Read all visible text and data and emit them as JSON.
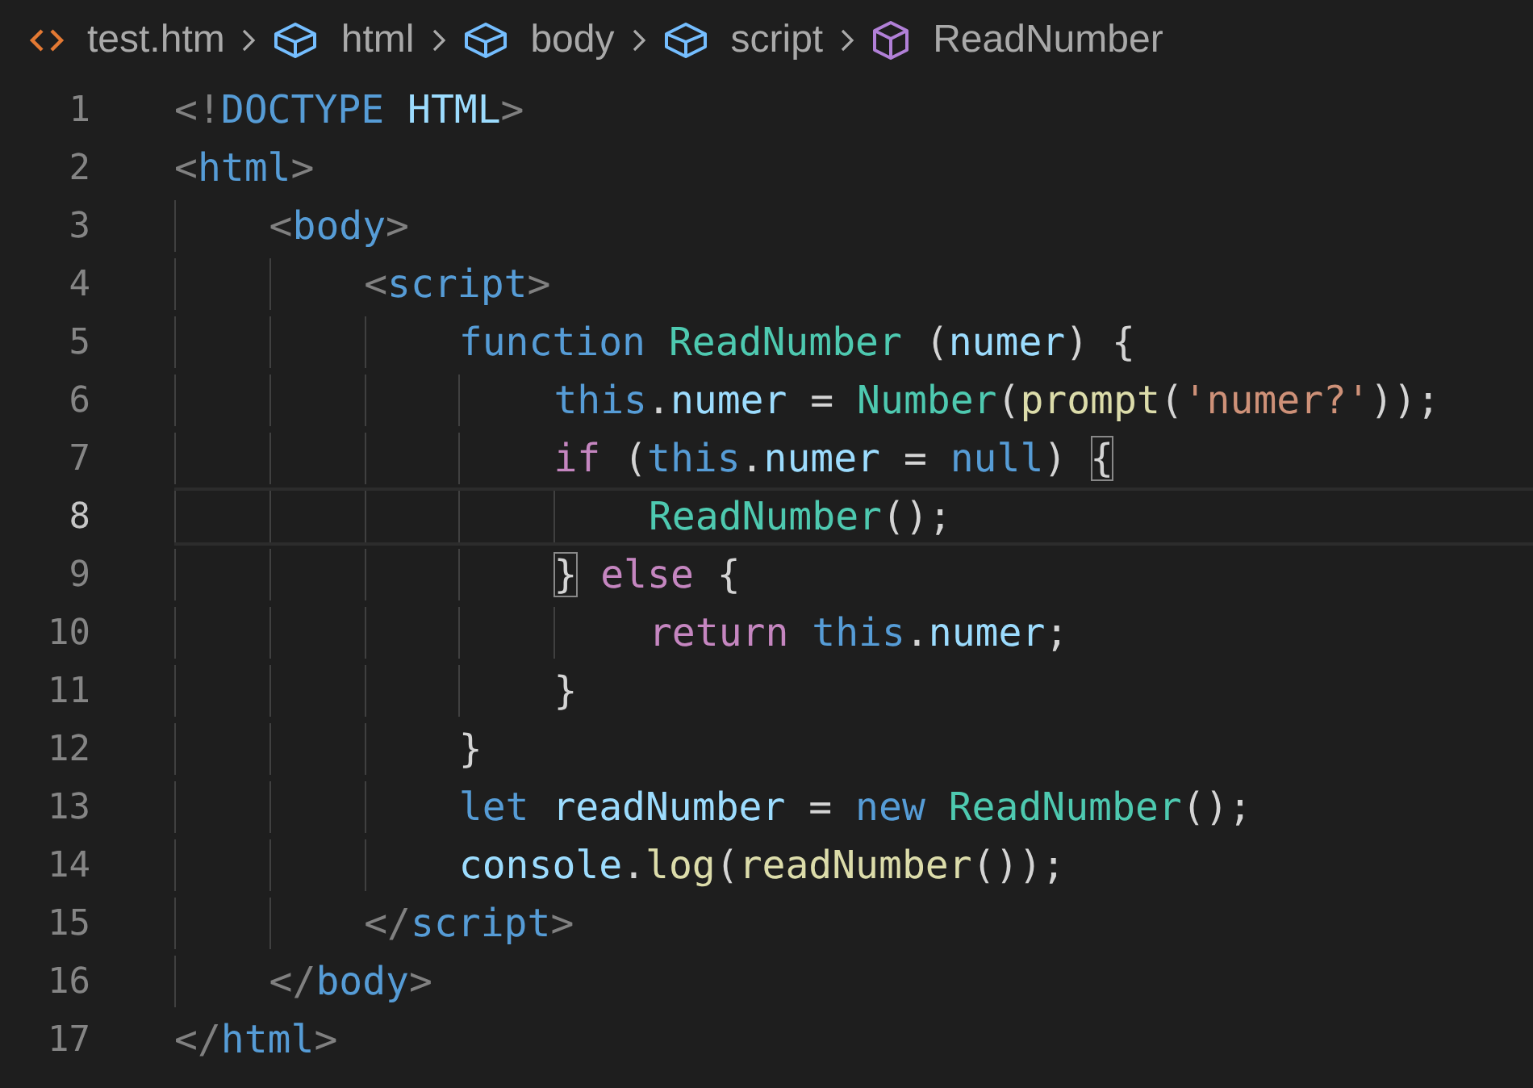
{
  "breadcrumbs": [
    {
      "kind": "file",
      "label": "test.htm"
    },
    {
      "kind": "element",
      "label": "html"
    },
    {
      "kind": "element",
      "label": "body"
    },
    {
      "kind": "element",
      "label": "script"
    },
    {
      "kind": "function",
      "label": "ReadNumber"
    }
  ],
  "lines": [
    {
      "number": "1",
      "current": false,
      "tokens": [
        {
          "kind": "punct",
          "text": "<!"
        },
        {
          "kind": "keyword",
          "text": "DOCTYPE "
        },
        {
          "kind": "var",
          "text": "HTML"
        },
        {
          "kind": "punct",
          "text": ">"
        }
      ]
    },
    {
      "number": "2",
      "current": false,
      "tokens": [
        {
          "kind": "punct",
          "text": "<"
        },
        {
          "kind": "keyword",
          "text": "html"
        },
        {
          "kind": "punct",
          "text": ">"
        }
      ]
    },
    {
      "number": "3",
      "current": false,
      "tokens": [
        {
          "kind": "punct",
          "text": "    <"
        },
        {
          "kind": "keyword",
          "text": "body"
        },
        {
          "kind": "punct",
          "text": ">"
        }
      ]
    },
    {
      "number": "4",
      "current": false,
      "tokens": [
        {
          "kind": "punct",
          "text": "        <"
        },
        {
          "kind": "keyword",
          "text": "script"
        },
        {
          "kind": "punct",
          "text": ">"
        }
      ]
    },
    {
      "number": "5",
      "current": false,
      "tokens": [
        {
          "kind": "keyword",
          "text": "            function "
        },
        {
          "kind": "type",
          "text": "ReadNumber"
        },
        {
          "kind": "text",
          "text": " ("
        },
        {
          "kind": "var",
          "text": "numer"
        },
        {
          "kind": "text",
          "text": ") {"
        }
      ]
    },
    {
      "number": "6",
      "current": false,
      "tokens": [
        {
          "kind": "keyword",
          "text": "                this"
        },
        {
          "kind": "text",
          "text": "."
        },
        {
          "kind": "var",
          "text": "numer"
        },
        {
          "kind": "text",
          "text": " = "
        },
        {
          "kind": "type",
          "text": "Number"
        },
        {
          "kind": "text",
          "text": "("
        },
        {
          "kind": "method",
          "text": "prompt"
        },
        {
          "kind": "text",
          "text": "("
        },
        {
          "kind": "string",
          "text": "'numer?'"
        },
        {
          "kind": "text",
          "text": "));"
        }
      ]
    },
    {
      "number": "7",
      "current": false,
      "tokens": [
        {
          "kind": "control",
          "text": "                if"
        },
        {
          "kind": "text",
          "text": " ("
        },
        {
          "kind": "keyword",
          "text": "this"
        },
        {
          "kind": "text",
          "text": "."
        },
        {
          "kind": "var",
          "text": "numer"
        },
        {
          "kind": "text",
          "text": " = "
        },
        {
          "kind": "keyword",
          "text": "null"
        },
        {
          "kind": "text",
          "text": ") "
        },
        {
          "kind": "bracket",
          "text": "{"
        }
      ]
    },
    {
      "number": "8",
      "current": true,
      "tokens": [
        {
          "kind": "type",
          "text": "                    ReadNumber"
        },
        {
          "kind": "text",
          "text": "();"
        }
      ]
    },
    {
      "number": "9",
      "current": false,
      "tokens": [
        {
          "kind": "bracket",
          "text": "                }"
        },
        {
          "kind": "control",
          "text": " else"
        },
        {
          "kind": "text",
          "text": " {"
        }
      ]
    },
    {
      "number": "10",
      "current": false,
      "tokens": [
        {
          "kind": "control",
          "text": "                    return "
        },
        {
          "kind": "keyword",
          "text": "this"
        },
        {
          "kind": "text",
          "text": "."
        },
        {
          "kind": "var",
          "text": "numer"
        },
        {
          "kind": "text",
          "text": ";"
        }
      ]
    },
    {
      "number": "11",
      "current": false,
      "tokens": [
        {
          "kind": "text",
          "text": "                }"
        }
      ]
    },
    {
      "number": "12",
      "current": false,
      "tokens": [
        {
          "kind": "text",
          "text": "            }"
        }
      ]
    },
    {
      "number": "13",
      "current": false,
      "tokens": [
        {
          "kind": "keyword",
          "text": "            let "
        },
        {
          "kind": "var",
          "text": "readNumber"
        },
        {
          "kind": "text",
          "text": " = "
        },
        {
          "kind": "keyword",
          "text": "new "
        },
        {
          "kind": "type",
          "text": "ReadNumber"
        },
        {
          "kind": "text",
          "text": "();"
        }
      ]
    },
    {
      "number": "14",
      "current": false,
      "tokens": [
        {
          "kind": "var",
          "text": "            console"
        },
        {
          "kind": "text",
          "text": "."
        },
        {
          "kind": "method",
          "text": "log"
        },
        {
          "kind": "text",
          "text": "("
        },
        {
          "kind": "method",
          "text": "readNumber"
        },
        {
          "kind": "text",
          "text": "());"
        }
      ]
    },
    {
      "number": "15",
      "current": false,
      "tokens": [
        {
          "kind": "punct",
          "text": "        </"
        },
        {
          "kind": "keyword",
          "text": "script"
        },
        {
          "kind": "punct",
          "text": ">"
        }
      ]
    },
    {
      "number": "16",
      "current": false,
      "tokens": [
        {
          "kind": "punct",
          "text": "    </"
        },
        {
          "kind": "keyword",
          "text": "body"
        },
        {
          "kind": "punct",
          "text": ">"
        }
      ]
    },
    {
      "number": "17",
      "current": false,
      "tokens": [
        {
          "kind": "punct",
          "text": "</"
        },
        {
          "kind": "keyword",
          "text": "html"
        },
        {
          "kind": "punct",
          "text": ">"
        }
      ]
    }
  ]
}
